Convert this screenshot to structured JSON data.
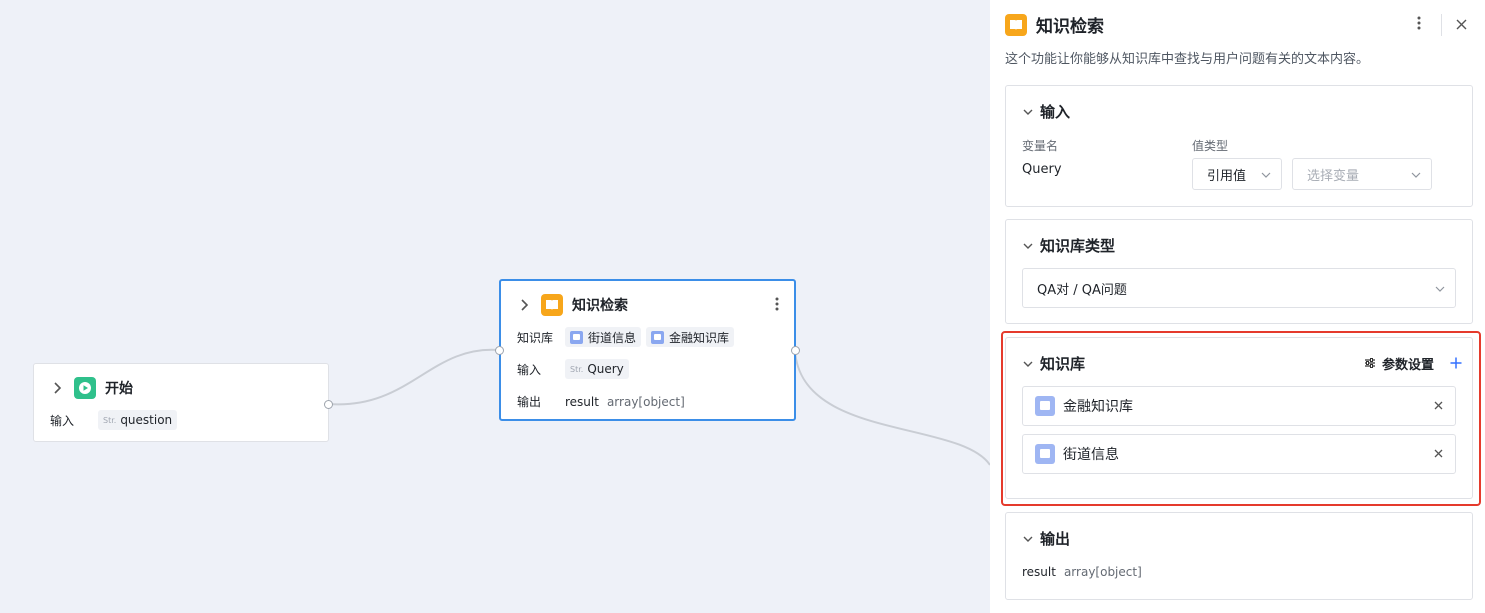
{
  "canvas": {
    "start_node": {
      "title": "开始",
      "input_label": "输入",
      "input_var": "question",
      "type_tag": "Str."
    },
    "kb_node": {
      "title": "知识检索",
      "kb_label": "知识库",
      "kb_chips": [
        "街道信息",
        "金融知识库"
      ],
      "input_label": "输入",
      "input_var": "Query",
      "type_tag": "Str.",
      "output_label": "输出",
      "output_name": "result",
      "output_type": "array[object]"
    }
  },
  "panel": {
    "title": "知识检索",
    "description": "这个功能让你能够从知识库中查找与用户问题有关的文本内容。",
    "input_section": {
      "title": "输入",
      "col_var": "变量名",
      "col_type": "值类型",
      "var_name": "Query",
      "value_type": "引用值",
      "variable_placeholder": "选择变量"
    },
    "kb_type_section": {
      "title": "知识库类型",
      "selected": "QA对 / QA问题"
    },
    "kb_section": {
      "title": "知识库",
      "settings_label": "参数设置",
      "items": [
        "金融知识库",
        "街道信息"
      ]
    },
    "output_section": {
      "title": "输出",
      "name": "result",
      "type": "array[object]"
    }
  },
  "colors": {
    "selected_border": "#3b8ee8",
    "highlight": "#e53a2c",
    "start_icon": "#2fc08b",
    "kb_icon": "#f7a61b",
    "accent": "#3370ff"
  }
}
